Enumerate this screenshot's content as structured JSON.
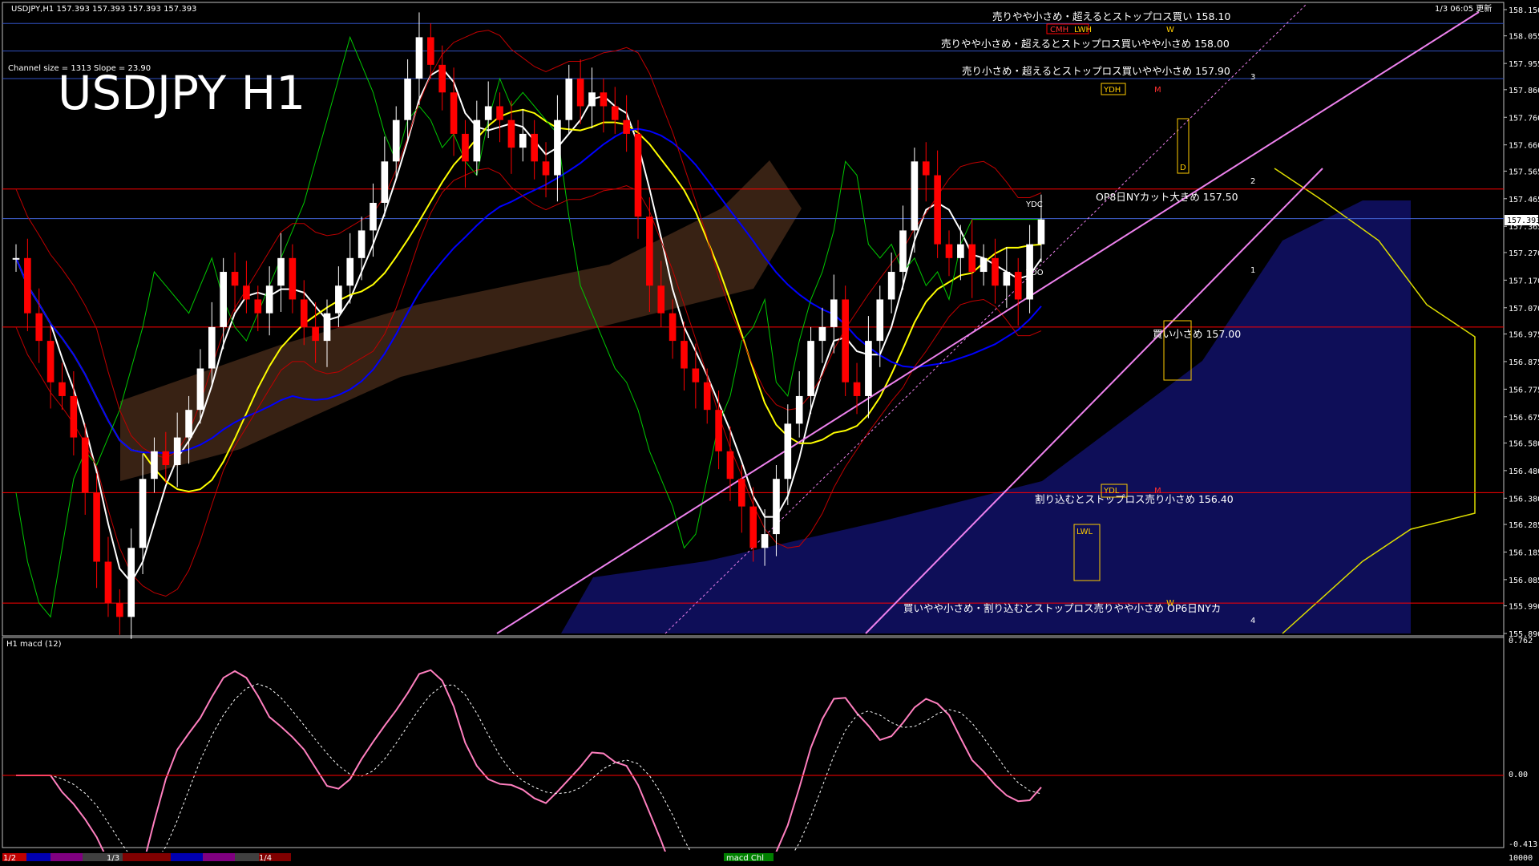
{
  "header": {
    "symbol_info": "USDJPY,H1  157.393 157.393 157.393 157.393",
    "datetime": "1/3 06:05 更新"
  },
  "main_chart": {
    "title": "USDJPY H1",
    "channel_info": "Channel size = 1313 Slope = 23.90",
    "current_price": "157.393",
    "price_ticks": [
      "158.150",
      "158.055",
      "157.955",
      "157.860",
      "157.760",
      "157.660",
      "157.565",
      "157.465",
      "157.365",
      "157.270",
      "157.170",
      "157.070",
      "156.975",
      "156.875",
      "156.775",
      "156.675",
      "156.580",
      "156.480",
      "156.380",
      "156.285",
      "156.185",
      "156.085",
      "155.990",
      "155.890"
    ]
  },
  "annotations": {
    "a1": "売りやや小さめ・超えるとストップロス買い 158.10",
    "a2": "売りやや小さめ・超えるとストップロス買いやや小さめ 158.00",
    "a3": "売り小さめ・超えるとストップロス買いやや小さめ 157.90",
    "a4": "OP8日NYカット大きめ 157.50",
    "a5": "買い小さめ 157.00",
    "a6": "割り込むとストップロス売り小さめ 156.40",
    "a7": "買いやや小さめ・割り込むとストップロス売りやや小さめ  OP6日NYカ"
  },
  "level_labels": {
    "cmh": "CMH",
    "lwh": "LWH",
    "w_top": "W",
    "ydh": "YDH",
    "m_top": "M",
    "ydc": "YDC",
    "ydo": "YDO",
    "d_box": "D",
    "ydl": "YDL",
    "m_low": "M",
    "lwl": "LWL",
    "w_low": "W",
    "n1": "1",
    "n2": "2",
    "n3": "3",
    "n4": "4"
  },
  "macd_panel": {
    "label": "H1  macd (12)",
    "ticks": [
      "0.762",
      "0.00",
      "-0.413"
    ]
  },
  "bottom_bar": {
    "tab1": "1/2",
    "tab2": "1/3",
    "tab3": "1/4",
    "tab4": "macd Chl",
    "right_value": "10000"
  },
  "colors": {
    "bull": "#ffffff",
    "bear": "#ff0000",
    "ma_white": "#ffffff",
    "ma_yellow": "#ffff00",
    "ma_blue": "#0000ff",
    "chikou": "#00c800",
    "channel": "#ee82ee",
    "level_line": "#ff0000",
    "kumo_blue": "#1a1aa0",
    "macd_main": "#ff7fbf",
    "macd_up": "#3fdf3f"
  },
  "chart_data": {
    "type": "line",
    "title": "USDJPY H1",
    "ylim": [
      155.89,
      158.15
    ],
    "horizontal_levels": [
      158.1,
      158.0,
      157.9,
      157.5,
      157.0,
      156.4,
      156.0
    ],
    "current_price": 157.393,
    "series": [
      {
        "name": "close",
        "values": [
          157.25,
          157.05,
          156.95,
          156.8,
          156.75,
          156.6,
          156.4,
          156.15,
          156.0,
          155.95,
          156.2,
          156.45,
          156.55,
          156.5,
          156.6,
          156.7,
          156.85,
          157.0,
          157.2,
          157.15,
          157.1,
          157.05,
          157.15,
          157.25,
          157.1,
          157.0,
          156.95,
          157.05,
          157.15,
          157.25,
          157.35,
          157.45,
          157.6,
          157.75,
          157.9,
          158.05,
          157.95,
          157.85,
          157.7,
          157.6,
          157.75,
          157.8,
          157.75,
          157.65,
          157.7,
          157.6,
          157.55,
          157.75,
          157.9,
          157.8,
          157.85,
          157.8,
          157.75,
          157.7,
          157.4,
          157.15,
          157.05,
          156.95,
          156.85,
          156.8,
          156.7,
          156.55,
          156.45,
          156.35,
          156.2,
          156.25,
          156.45,
          156.65,
          156.75,
          156.95,
          157.0,
          157.1,
          156.8,
          156.75,
          156.95,
          157.1,
          157.2,
          157.35,
          157.6,
          157.55,
          157.3,
          157.25,
          157.3,
          157.2,
          157.25,
          157.15,
          157.2,
          157.1,
          157.3,
          157.39
        ]
      }
    ]
  }
}
